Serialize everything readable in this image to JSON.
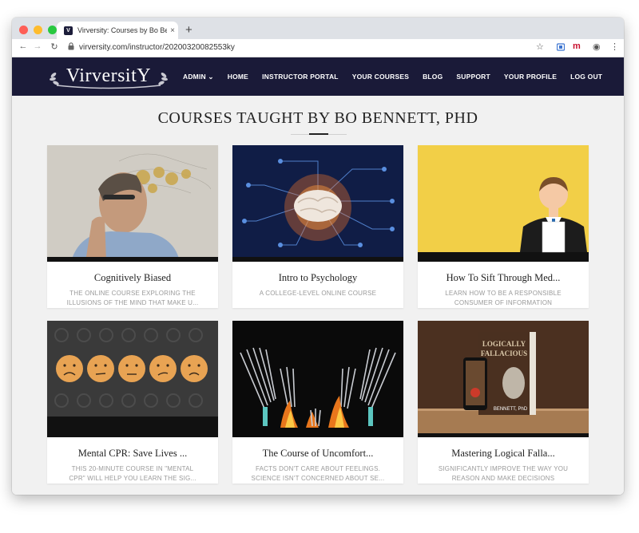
{
  "browser": {
    "tab_title": "Virversity: Courses by Bo Bennett...",
    "tab_close": "×",
    "new_tab": "+",
    "url": "virversity.com/instructor/20200320082553ky",
    "favicon_letter": "V"
  },
  "site": {
    "logo": "VirversitY",
    "nav": [
      "ADMIN ⌄",
      "HOME",
      "INSTRUCTOR PORTAL",
      "YOUR COURSES",
      "BLOG",
      "SUPPORT",
      "YOUR PROFILE",
      "LOG OUT"
    ]
  },
  "page": {
    "heading": "COURSES TAUGHT BY BO BENNETT, PHD"
  },
  "courses": [
    {
      "title": "Cognitively Biased",
      "desc": "THE ONLINE COURSE EXPLORING THE ILLUSIONS OF THE MIND THAT MAKE U..."
    },
    {
      "title": "Intro to Psychology",
      "desc": "A COLLEGE-LEVEL ONLINE COURSE"
    },
    {
      "title": "How To Sift Through Med...",
      "desc": "LEARN HOW TO BE A RESPONSIBLE CONSUMER OF INFORMATION"
    },
    {
      "title": "Mental CPR: Save Lives ...",
      "desc": "THIS 20-MINUTE COURSE IN \"MENTAL CPR\" WILL HELP YOU LEARN THE SIG..."
    },
    {
      "title": "The Course of Uncomfort...",
      "desc": "FACTS DON'T CARE ABOUT FEELINGS. SCIENCE ISN'T CONCERNED ABOUT SE..."
    },
    {
      "title": "Mastering Logical Falla...",
      "desc": "SIGNIFICANTLY IMPROVE THE WAY YOU REASON AND MAKE DECISIONS"
    }
  ],
  "book_cover": {
    "title_line1": "LOGICALLY",
    "title_line2": "FALLACIOUS",
    "author": "BENNETT, PhD"
  },
  "icons": {
    "back": "←",
    "forward": "→",
    "reload": "↻",
    "lock": "🔒",
    "star": "☆",
    "account": "◉",
    "menu": "⋮",
    "ext_m": "m"
  }
}
